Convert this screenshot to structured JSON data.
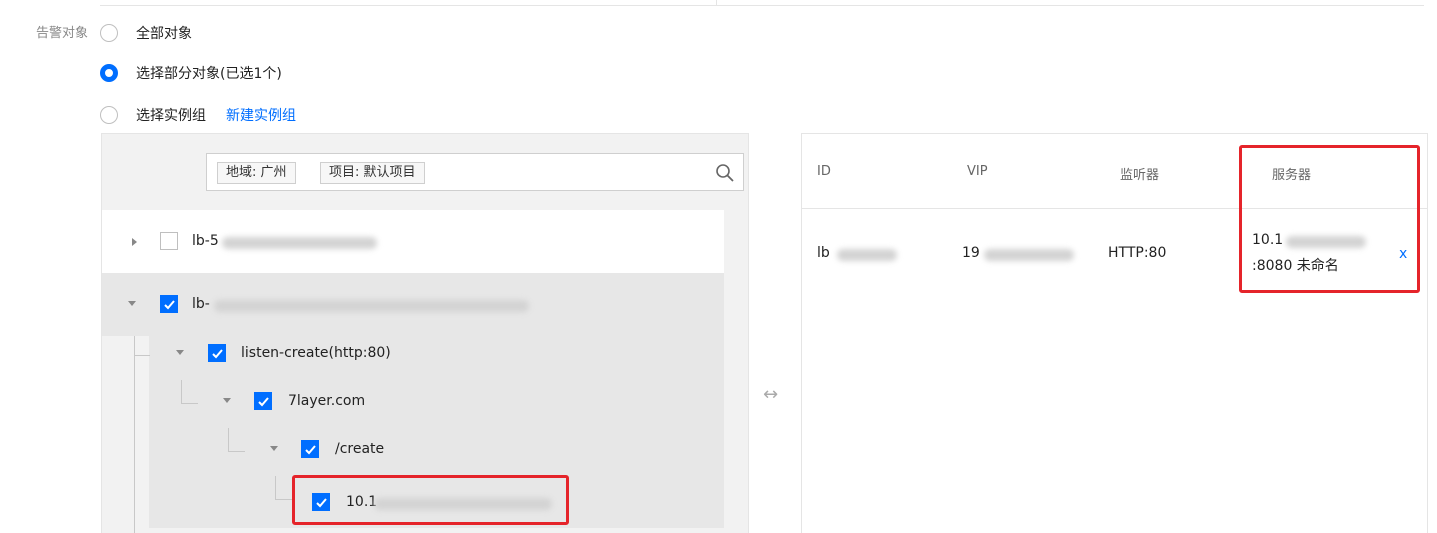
{
  "form": {
    "label": "告警对象",
    "options": [
      {
        "label": "全部对象",
        "checked": false
      },
      {
        "label": "选择部分对象(已选1个)",
        "checked": true
      },
      {
        "label": "选择实例组",
        "checked": false
      }
    ],
    "new_group_link": "新建实例组"
  },
  "filter": {
    "tags": [
      "地域: 广州",
      "项目: 默认项目"
    ],
    "icon": "search-icon"
  },
  "tree": {
    "nodes": [
      {
        "label": "lb-5",
        "checked": false,
        "expanded": false
      },
      {
        "label": "lb-",
        "checked": true,
        "expanded": true
      },
      {
        "label": "listen-create(http:80)",
        "checked": true,
        "expanded": true
      },
      {
        "label": "7layer.com",
        "checked": true,
        "expanded": true
      },
      {
        "label": "/create",
        "checked": true,
        "expanded": true
      },
      {
        "label": "10.1",
        "checked": true,
        "expanded": false
      }
    ]
  },
  "transfer_icon": "↔",
  "selected_table": {
    "columns": [
      "ID",
      "VIP",
      "监听器",
      "服务器"
    ],
    "rows": [
      {
        "id": "lb",
        "vip": "19",
        "listener": "HTTP:80",
        "server_line1": "10.1",
        "server_line2": ":8080 未命名",
        "remove": "x"
      }
    ]
  },
  "colors": {
    "accent": "#006eff",
    "highlight": "#e5242a"
  }
}
